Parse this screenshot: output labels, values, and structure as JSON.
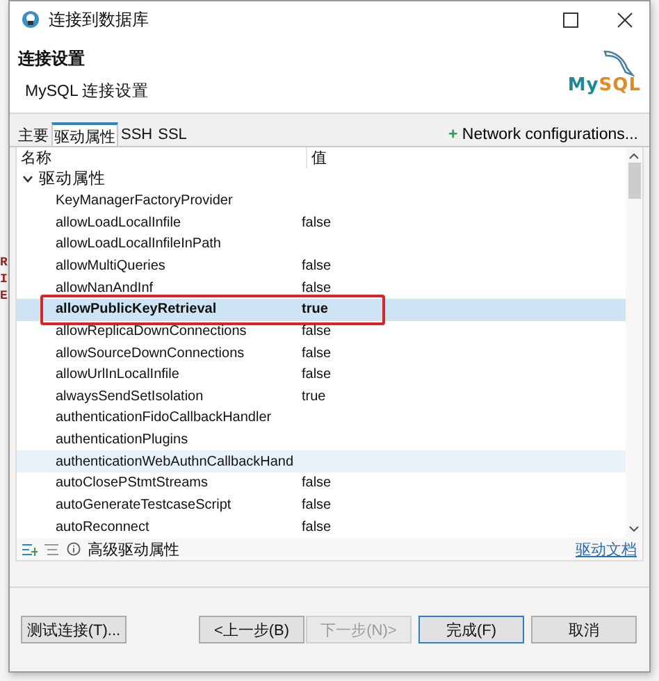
{
  "background_editor": {
    "lines": [
      "R",
      "I",
      "E"
    ]
  },
  "window": {
    "title": "连接到数据库"
  },
  "header": {
    "title": "连接设置",
    "subtitle": "MySQL 连接设置",
    "logo": {
      "text_1": "My",
      "text_2": "SQL"
    }
  },
  "tabs": [
    {
      "label": "主要",
      "selected": false
    },
    {
      "label": "驱动属性",
      "selected": true
    },
    {
      "label": "SSH",
      "selected": false
    },
    {
      "label": "SSL",
      "selected": false
    }
  ],
  "network_button": {
    "icon": "+",
    "label": "Network configurations..."
  },
  "table": {
    "columns": [
      "名称",
      "值"
    ],
    "group": {
      "label": "驱动属性",
      "expanded": true,
      "children": [
        {
          "name": "KeyManagerFactoryProvider",
          "selected": false,
          "highlighted": false,
          "annotated": false
        },
        {
          "name": "allowLoadLocalInfile",
          "value": "false",
          "selected": false,
          "highlighted": false,
          "annotated": false
        },
        {
          "name": "allowLoadLocalInfileInPath",
          "selected": false,
          "highlighted": false,
          "annotated": false
        },
        {
          "name": "allowMultiQueries",
          "value": "false",
          "selected": false,
          "highlighted": false,
          "annotated": false
        },
        {
          "name": "allowNanAndInf",
          "value": "false",
          "selected": false,
          "highlighted": false,
          "annotated": false
        },
        {
          "name": "allowPublicKeyRetrieval",
          "value": "true",
          "selected": true,
          "highlighted": false,
          "annotated": true
        },
        {
          "name": "allowReplicaDownConnections",
          "value": "false",
          "selected": false,
          "highlighted": false,
          "annotated": false
        },
        {
          "name": "allowSourceDownConnections",
          "value": "false",
          "selected": false,
          "highlighted": false,
          "annotated": false
        },
        {
          "name": "allowUrlInLocalInfile",
          "value": "false",
          "selected": false,
          "highlighted": false,
          "annotated": false
        },
        {
          "name": "alwaysSendSetIsolation",
          "value": "true",
          "selected": false,
          "highlighted": false,
          "annotated": false
        },
        {
          "name": "authenticationFidoCallbackHandler",
          "selected": false,
          "highlighted": false,
          "annotated": false
        },
        {
          "name": "authenticationPlugins",
          "selected": false,
          "highlighted": false,
          "annotated": false
        },
        {
          "name": "authenticationWebAuthnCallbackHand",
          "selected": false,
          "highlighted": true,
          "annotated": false
        },
        {
          "name": "autoClosePStmtStreams",
          "value": "false",
          "selected": false,
          "highlighted": false,
          "annotated": false
        },
        {
          "name": "autoGenerateTestcaseScript",
          "value": "false",
          "selected": false,
          "highlighted": false,
          "annotated": false
        },
        {
          "name": "autoReconnect",
          "value": "false",
          "selected": false,
          "highlighted": false,
          "annotated": false
        }
      ]
    }
  },
  "table_footer": {
    "label": "高级驱动属性",
    "link": "驱动文档"
  },
  "buttons": [
    {
      "label": "测试连接(T)...",
      "disabled": false,
      "default": false
    },
    {
      "label": "<上一步(B)",
      "disabled": false,
      "default": false
    },
    {
      "label": "下一步(N)>",
      "disabled": true,
      "default": false
    },
    {
      "label": "完成(F)",
      "disabled": false,
      "default": true
    },
    {
      "label": "取消",
      "disabled": false,
      "default": false
    }
  ]
}
